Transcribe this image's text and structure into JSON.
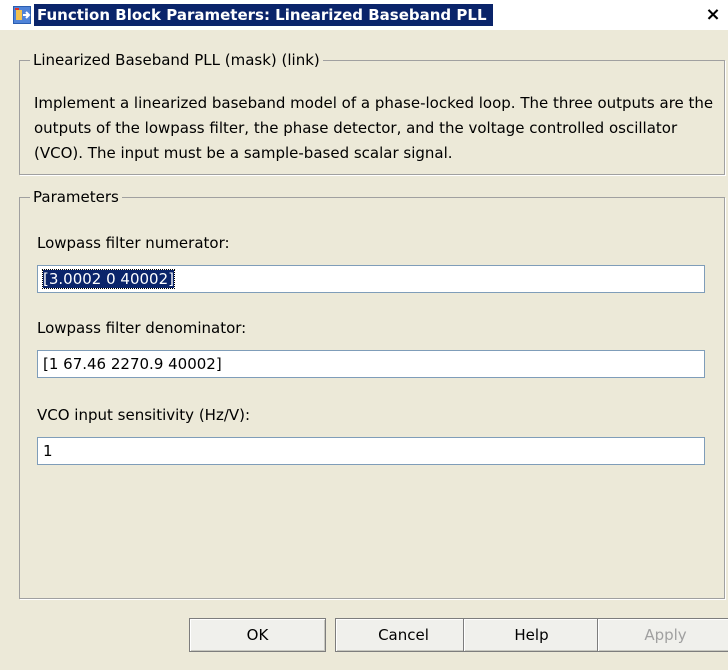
{
  "window": {
    "title": "Function Block Parameters: Linearized Baseband PLL",
    "close_glyph": "×"
  },
  "mask": {
    "legend": "Linearized Baseband PLL (mask) (link)",
    "description": "Implement a linearized baseband model of a phase-locked loop.  The three outputs are the outputs of the lowpass filter, the phase detector, and the voltage controlled oscillator (VCO). The input must be a sample-based scalar signal."
  },
  "parameters": {
    "legend": "Parameters",
    "fields": [
      {
        "label": "Lowpass filter numerator:",
        "value": "[3.0002  0  40002]"
      },
      {
        "label": "Lowpass filter denominator:",
        "value": "[1  67.46  2270.9  40002]"
      },
      {
        "label": "VCO input sensitivity (Hz/V):",
        "value": "1"
      }
    ]
  },
  "buttons": {
    "ok": "OK",
    "cancel": "Cancel",
    "help": "Help",
    "apply": "Apply"
  },
  "colors": {
    "title_highlight": "#0a246a",
    "dialog_bg": "#ece9d8",
    "disabled_text": "#a0a0a0"
  }
}
